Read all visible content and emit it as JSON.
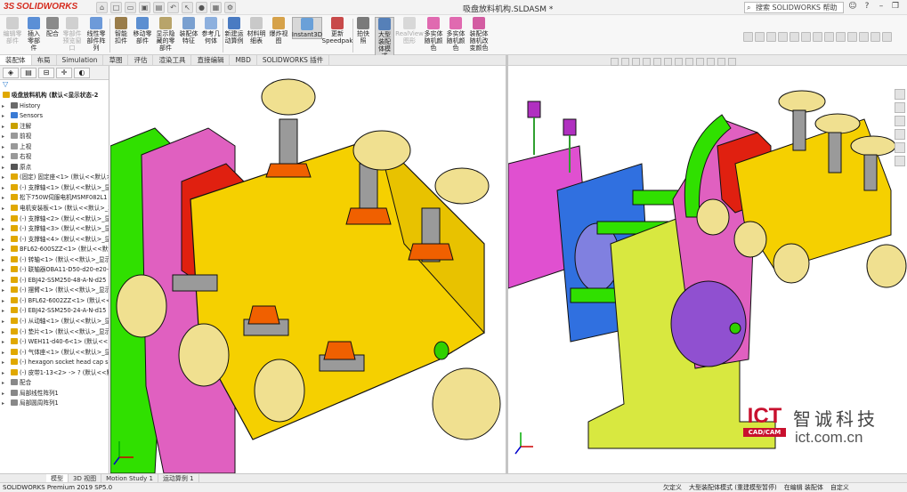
{
  "app": {
    "brand": "SOLIDWORKS",
    "document_title": "吸盘放料机构.SLDASM *"
  },
  "search": {
    "placeholder": "搜索 SOLIDWORKS 帮助"
  },
  "ribbon": {
    "buttons": [
      {
        "label": "编辑零部件",
        "disabled": true
      },
      {
        "label": "插入零部件",
        "disabled": false
      },
      {
        "label": "配合",
        "disabled": false
      },
      {
        "label": "零部件预览窗口",
        "disabled": true
      },
      {
        "label": "线性零部件阵列",
        "disabled": false
      },
      {
        "label": "智能扣件",
        "disabled": false
      },
      {
        "label": "移动零部件",
        "disabled": false
      },
      {
        "label": "显示隐藏的零部件",
        "disabled": false
      },
      {
        "label": "装配体特征",
        "disabled": false
      },
      {
        "label": "参考几何体",
        "disabled": false
      },
      {
        "label": "新建运动算例",
        "disabled": false
      },
      {
        "label": "材料明细表",
        "disabled": false
      },
      {
        "label": "爆炸视图",
        "disabled": false
      },
      {
        "label": "Instant3D",
        "disabled": false,
        "active": true
      },
      {
        "label": "更新Speedpak",
        "disabled": false
      },
      {
        "label": "拍快照",
        "disabled": false
      },
      {
        "label": "大型装配体模式",
        "disabled": false,
        "active": true
      },
      {
        "label": "RealView图形",
        "disabled": true
      },
      {
        "label": "多实体随机颜色",
        "disabled": false
      },
      {
        "label": "多实体随机颜色",
        "disabled": false
      },
      {
        "label": "装配体随机改变颜色",
        "disabled": false
      }
    ]
  },
  "command_tabs": [
    "装配体",
    "布局",
    "Simulation",
    "草图",
    "评估",
    "渲染工具",
    "直接编辑",
    "MBD",
    "SOLIDWORKS 插件"
  ],
  "tree": {
    "root": "吸盘放料机构 (默认<显示状态-2",
    "items": [
      {
        "label": "History",
        "icon": "history-icon",
        "color": "#6a6a6a"
      },
      {
        "label": "Sensors",
        "icon": "sensor-icon",
        "color": "#3a7bd5"
      },
      {
        "label": "注解",
        "icon": "annotation-icon",
        "color": "#c8a000"
      },
      {
        "label": "前视",
        "icon": "plane-icon",
        "color": "#999"
      },
      {
        "label": "上视",
        "icon": "plane-icon",
        "color": "#999"
      },
      {
        "label": "右视",
        "icon": "plane-icon",
        "color": "#999"
      },
      {
        "label": "原点",
        "icon": "origin-icon",
        "color": "#555"
      },
      {
        "label": "(固定) 固定座<1> (默认<<默认>_",
        "icon": "part-icon",
        "color": "#e0a800"
      },
      {
        "label": "(-) 支撑轴<1> (默认<<默认>_显",
        "icon": "part-icon",
        "color": "#e0a800"
      },
      {
        "label": "松下750W伺服电机MSMF082L1",
        "icon": "part-icon",
        "color": "#e0a800"
      },
      {
        "label": "电机安装板<1> (默认<<默认>_3",
        "icon": "part-icon",
        "color": "#e0a800"
      },
      {
        "label": "(-) 支撑轴<2> (默认<<默认>_显",
        "icon": "part-icon",
        "color": "#e0a800"
      },
      {
        "label": "(-) 支撑轴<3> (默认<<默认>_显",
        "icon": "part-icon",
        "color": "#e0a800"
      },
      {
        "label": "(-) 支撑轴<4> (默认<<默认>_显",
        "icon": "part-icon",
        "color": "#e0a800"
      },
      {
        "label": "BFL62-600SZZ<1> (默认<<默认",
        "icon": "part-icon",
        "color": "#e0a800"
      },
      {
        "label": "(-) 转轴<1> (默认<<默认>_显示",
        "icon": "part-icon",
        "color": "#e0a800"
      },
      {
        "label": "(-) 联轴器OBA11-D50-d20-e20-",
        "icon": "part-icon",
        "color": "#e0a800"
      },
      {
        "label": "(-) EBJ42-SSM250-48-A-N-d25",
        "icon": "part-icon",
        "color": "#e0a800"
      },
      {
        "label": "(-) 摆臂<1> (默认<<默认>_显示",
        "icon": "part-icon",
        "color": "#e0a800"
      },
      {
        "label": "(-) BFL62-6002ZZ<1> (默认<<默",
        "icon": "part-icon",
        "color": "#e0a800"
      },
      {
        "label": "(-) EBJ42-SSM250-24-A-N-d15",
        "icon": "part-icon",
        "color": "#e0a800"
      },
      {
        "label": "(-) 从动轴<1> (默认<<默认>_显",
        "icon": "part-icon",
        "color": "#e0a800"
      },
      {
        "label": "(-) 垫片<1> (默认<<默认>_显示",
        "icon": "part-icon",
        "color": "#e0a800"
      },
      {
        "label": "(-) WEH11-d40-6<1> (默认<<De",
        "icon": "part-icon",
        "color": "#e0a800"
      },
      {
        "label": "(-) 气体座<1> (默认<<默认>_显",
        "icon": "part-icon",
        "color": "#e0a800"
      },
      {
        "label": "(-) hexagon socket head cap s",
        "icon": "part-icon",
        "color": "#e0a800"
      },
      {
        "label": "(-) 皮带1-13<2> -> ? (默认<<默认",
        "icon": "part-icon",
        "color": "#e0a800"
      },
      {
        "label": "配合",
        "icon": "mate-icon",
        "color": "#888"
      },
      {
        "label": "局部线性阵列1",
        "icon": "pattern-icon",
        "color": "#888"
      },
      {
        "label": "局部圆周阵列1",
        "icon": "pattern-icon",
        "color": "#888"
      }
    ]
  },
  "watermark": {
    "ict": "ICT",
    "sub": "CAD/CAM",
    "cn": "智诚科技",
    "url": "ict.com.cn"
  },
  "bottom_tabs": [
    "模型",
    "3D 视图",
    "Motion Study 1",
    "运动算例 1"
  ],
  "status": {
    "left": "SOLIDWORKS Premium 2019 SP5.0",
    "right": [
      "欠定义",
      "大型装配体模式 (重建模型暂停)",
      "在编辑 装配体",
      "自定义"
    ]
  }
}
